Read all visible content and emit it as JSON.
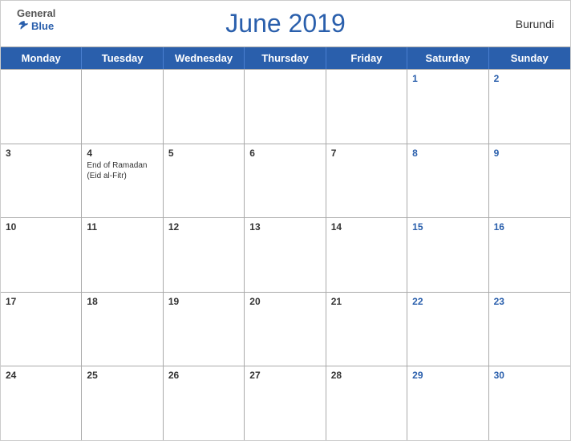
{
  "header": {
    "logo_general": "General",
    "logo_blue": "Blue",
    "month_title": "June 2019",
    "country": "Burundi"
  },
  "days_of_week": [
    "Monday",
    "Tuesday",
    "Wednesday",
    "Thursday",
    "Friday",
    "Saturday",
    "Sunday"
  ],
  "weeks": [
    [
      {
        "date": "",
        "weekend": false,
        "event": ""
      },
      {
        "date": "",
        "weekend": false,
        "event": ""
      },
      {
        "date": "",
        "weekend": false,
        "event": ""
      },
      {
        "date": "",
        "weekend": false,
        "event": ""
      },
      {
        "date": "",
        "weekend": false,
        "event": ""
      },
      {
        "date": "1",
        "weekend": true,
        "event": ""
      },
      {
        "date": "2",
        "weekend": true,
        "event": ""
      }
    ],
    [
      {
        "date": "3",
        "weekend": false,
        "event": ""
      },
      {
        "date": "4",
        "weekend": false,
        "event": "End of Ramadan (Eid al-Fitr)"
      },
      {
        "date": "5",
        "weekend": false,
        "event": ""
      },
      {
        "date": "6",
        "weekend": false,
        "event": ""
      },
      {
        "date": "7",
        "weekend": false,
        "event": ""
      },
      {
        "date": "8",
        "weekend": true,
        "event": ""
      },
      {
        "date": "9",
        "weekend": true,
        "event": ""
      }
    ],
    [
      {
        "date": "10",
        "weekend": false,
        "event": ""
      },
      {
        "date": "11",
        "weekend": false,
        "event": ""
      },
      {
        "date": "12",
        "weekend": false,
        "event": ""
      },
      {
        "date": "13",
        "weekend": false,
        "event": ""
      },
      {
        "date": "14",
        "weekend": false,
        "event": ""
      },
      {
        "date": "15",
        "weekend": true,
        "event": ""
      },
      {
        "date": "16",
        "weekend": true,
        "event": ""
      }
    ],
    [
      {
        "date": "17",
        "weekend": false,
        "event": ""
      },
      {
        "date": "18",
        "weekend": false,
        "event": ""
      },
      {
        "date": "19",
        "weekend": false,
        "event": ""
      },
      {
        "date": "20",
        "weekend": false,
        "event": ""
      },
      {
        "date": "21",
        "weekend": false,
        "event": ""
      },
      {
        "date": "22",
        "weekend": true,
        "event": ""
      },
      {
        "date": "23",
        "weekend": true,
        "event": ""
      }
    ],
    [
      {
        "date": "24",
        "weekend": false,
        "event": ""
      },
      {
        "date": "25",
        "weekend": false,
        "event": ""
      },
      {
        "date": "26",
        "weekend": false,
        "event": ""
      },
      {
        "date": "27",
        "weekend": false,
        "event": ""
      },
      {
        "date": "28",
        "weekend": false,
        "event": ""
      },
      {
        "date": "29",
        "weekend": true,
        "event": ""
      },
      {
        "date": "30",
        "weekend": true,
        "event": ""
      }
    ]
  ]
}
